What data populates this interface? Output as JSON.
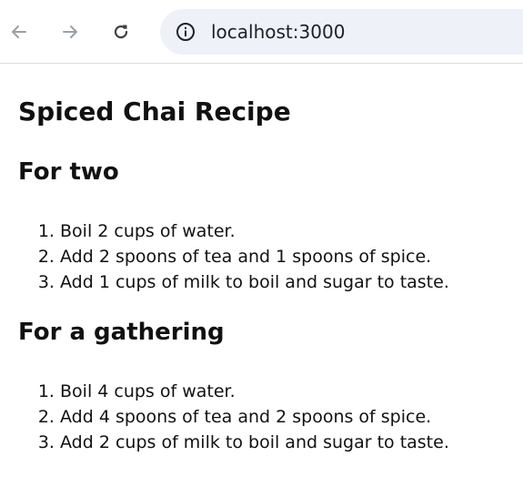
{
  "browser": {
    "url": "localhost:3000",
    "icons": [
      "back-arrow-icon",
      "forward-arrow-icon",
      "reload-icon",
      "info-icon"
    ]
  },
  "page": {
    "title": "Spiced Chai Recipe",
    "sections": [
      {
        "heading": "For two",
        "steps": [
          "Boil 2 cups of water.",
          "Add 2 spoons of tea and 1 spoons of spice.",
          "Add 1 cups of milk to boil and sugar to taste."
        ]
      },
      {
        "heading": "For a gathering",
        "steps": [
          "Boil 4 cups of water.",
          "Add 4 spoons of tea and 2 spoons of spice.",
          "Add 2 cups of milk to boil and sugar to taste."
        ]
      }
    ]
  }
}
